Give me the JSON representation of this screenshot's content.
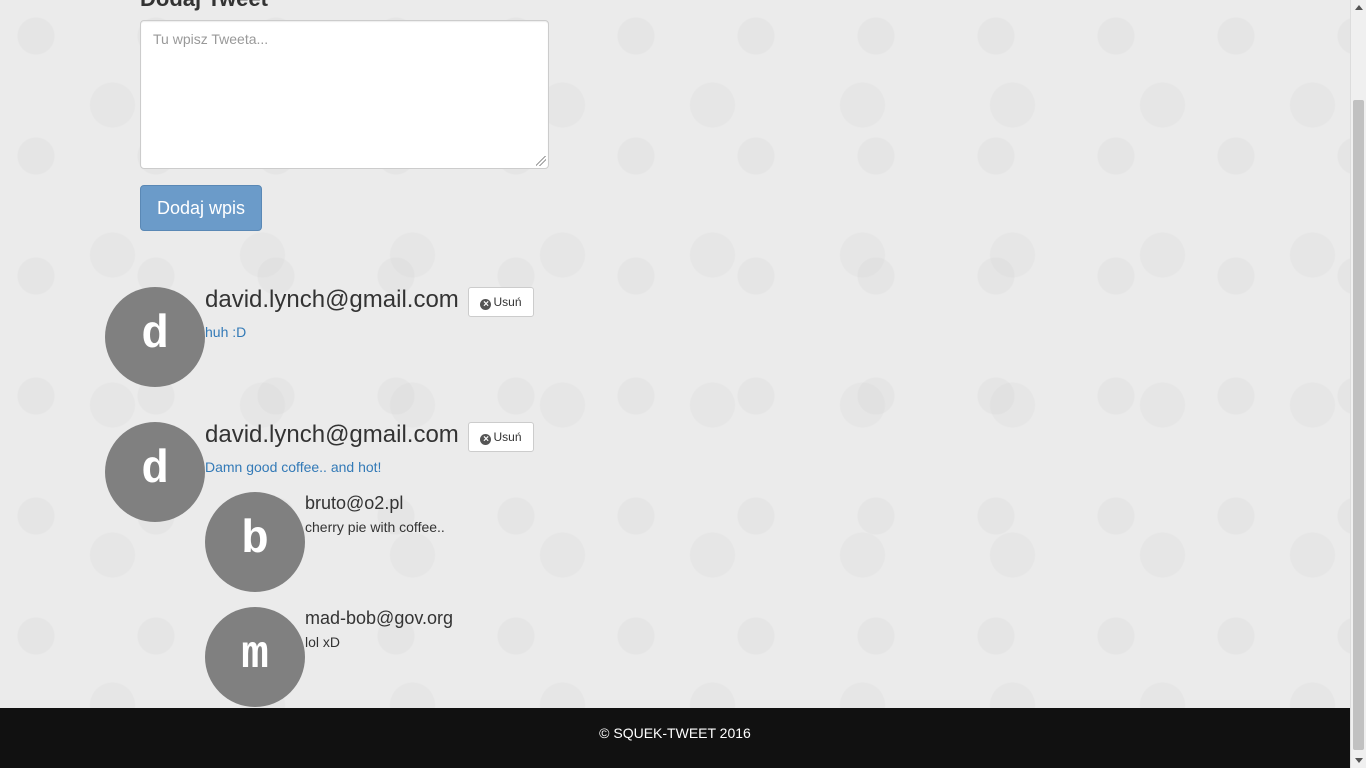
{
  "form": {
    "heading": "Dodaj Tweet",
    "textarea_placeholder": "Tu wpisz Tweeta...",
    "submit_label": "Dodaj wpis"
  },
  "tweets": [
    {
      "avatar_letter": "d",
      "author": "david.lynch@gmail.com",
      "delete_label": "Usuń",
      "text": "huh :D"
    },
    {
      "avatar_letter": "d",
      "author": "david.lynch@gmail.com",
      "delete_label": "Usuń",
      "text": "Damn good coffee.. and hot!",
      "replies": [
        {
          "avatar_letter": "b",
          "author": "bruto@o2.pl",
          "text": "cherry pie with coffee.."
        },
        {
          "avatar_letter": "m",
          "author": "mad-bob@gov.org",
          "text": "lol xD"
        }
      ]
    }
  ],
  "footer": {
    "text": "© SQUEK-TWEET 2016"
  },
  "colors": {
    "primary_button": "#6b9bc9",
    "link": "#337ab7",
    "avatar": "#808080",
    "footer_bg": "#111111"
  },
  "icons": {
    "delete": "remove-circle-icon"
  }
}
